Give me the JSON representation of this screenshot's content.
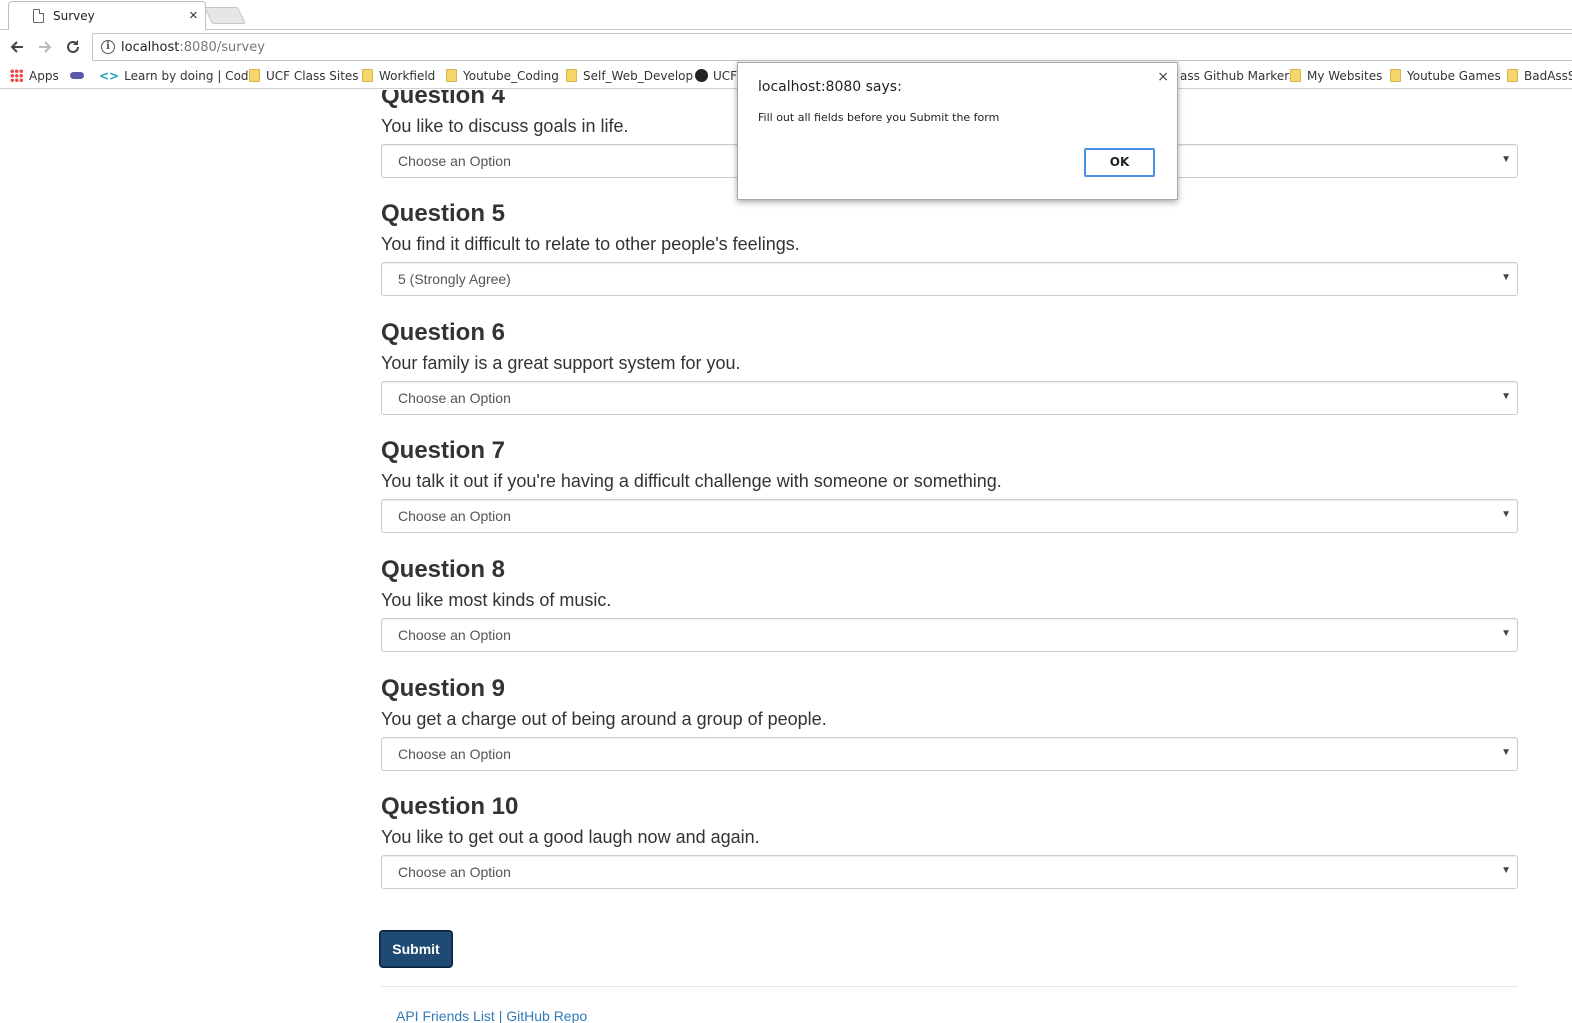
{
  "browser": {
    "tab_title": "Survey",
    "tab_close": "×",
    "url_host": "localhost",
    "url_path": ":8080/survey",
    "back_icon": "arrow-left",
    "forward_icon": "arrow-right",
    "reload_icon": "reload"
  },
  "bookmarks": [
    {
      "label": "Apps",
      "icon": "apps-grid-icon"
    },
    {
      "label": "",
      "icon": "link-icon"
    },
    {
      "label": "Learn by doing | Code",
      "icon": "code-icon"
    },
    {
      "label": "UCF Class Sites",
      "icon": "folder-icon"
    },
    {
      "label": "Workfield",
      "icon": "folder-icon"
    },
    {
      "label": "Youtube_Coding",
      "icon": "folder-icon"
    },
    {
      "label": "Self_Web_Develop",
      "icon": "folder-icon"
    },
    {
      "label": "UCF",
      "icon": "github-icon"
    },
    {
      "label": "ass Github Markers",
      "icon": ""
    },
    {
      "label": "My Websites",
      "icon": "folder-icon"
    },
    {
      "label": "Youtube Games",
      "icon": "folder-icon"
    },
    {
      "label": "BadAssS",
      "icon": "folder-icon"
    }
  ],
  "questions": [
    {
      "title": "Question 4",
      "text": "You like to discuss goals in life.",
      "value": "Choose an Option"
    },
    {
      "title": "Question 5",
      "text": "You find it difficult to relate to other people's feelings.",
      "value": "5 (Strongly Agree)"
    },
    {
      "title": "Question 6",
      "text": "Your family is a great support system for you.",
      "value": "Choose an Option"
    },
    {
      "title": "Question 7",
      "text": "You talk it out if you're having a difficult challenge with someone or something.",
      "value": "Choose an Option"
    },
    {
      "title": "Question 8",
      "text": "You like most kinds of music.",
      "value": "Choose an Option"
    },
    {
      "title": "Question 9",
      "text": "You get a charge out of being around a group of people.",
      "value": "Choose an Option"
    },
    {
      "title": "Question 10",
      "text": "You like to get out a good laugh now and again.",
      "value": "Choose an Option"
    }
  ],
  "submit_label": "Submit",
  "footer": {
    "links_text": "API Friends List | GitHub Repo"
  },
  "dialog": {
    "title": "localhost:8080 says:",
    "message": "Fill out all fields before you Submit the form",
    "ok_label": "OK",
    "close": "×"
  }
}
